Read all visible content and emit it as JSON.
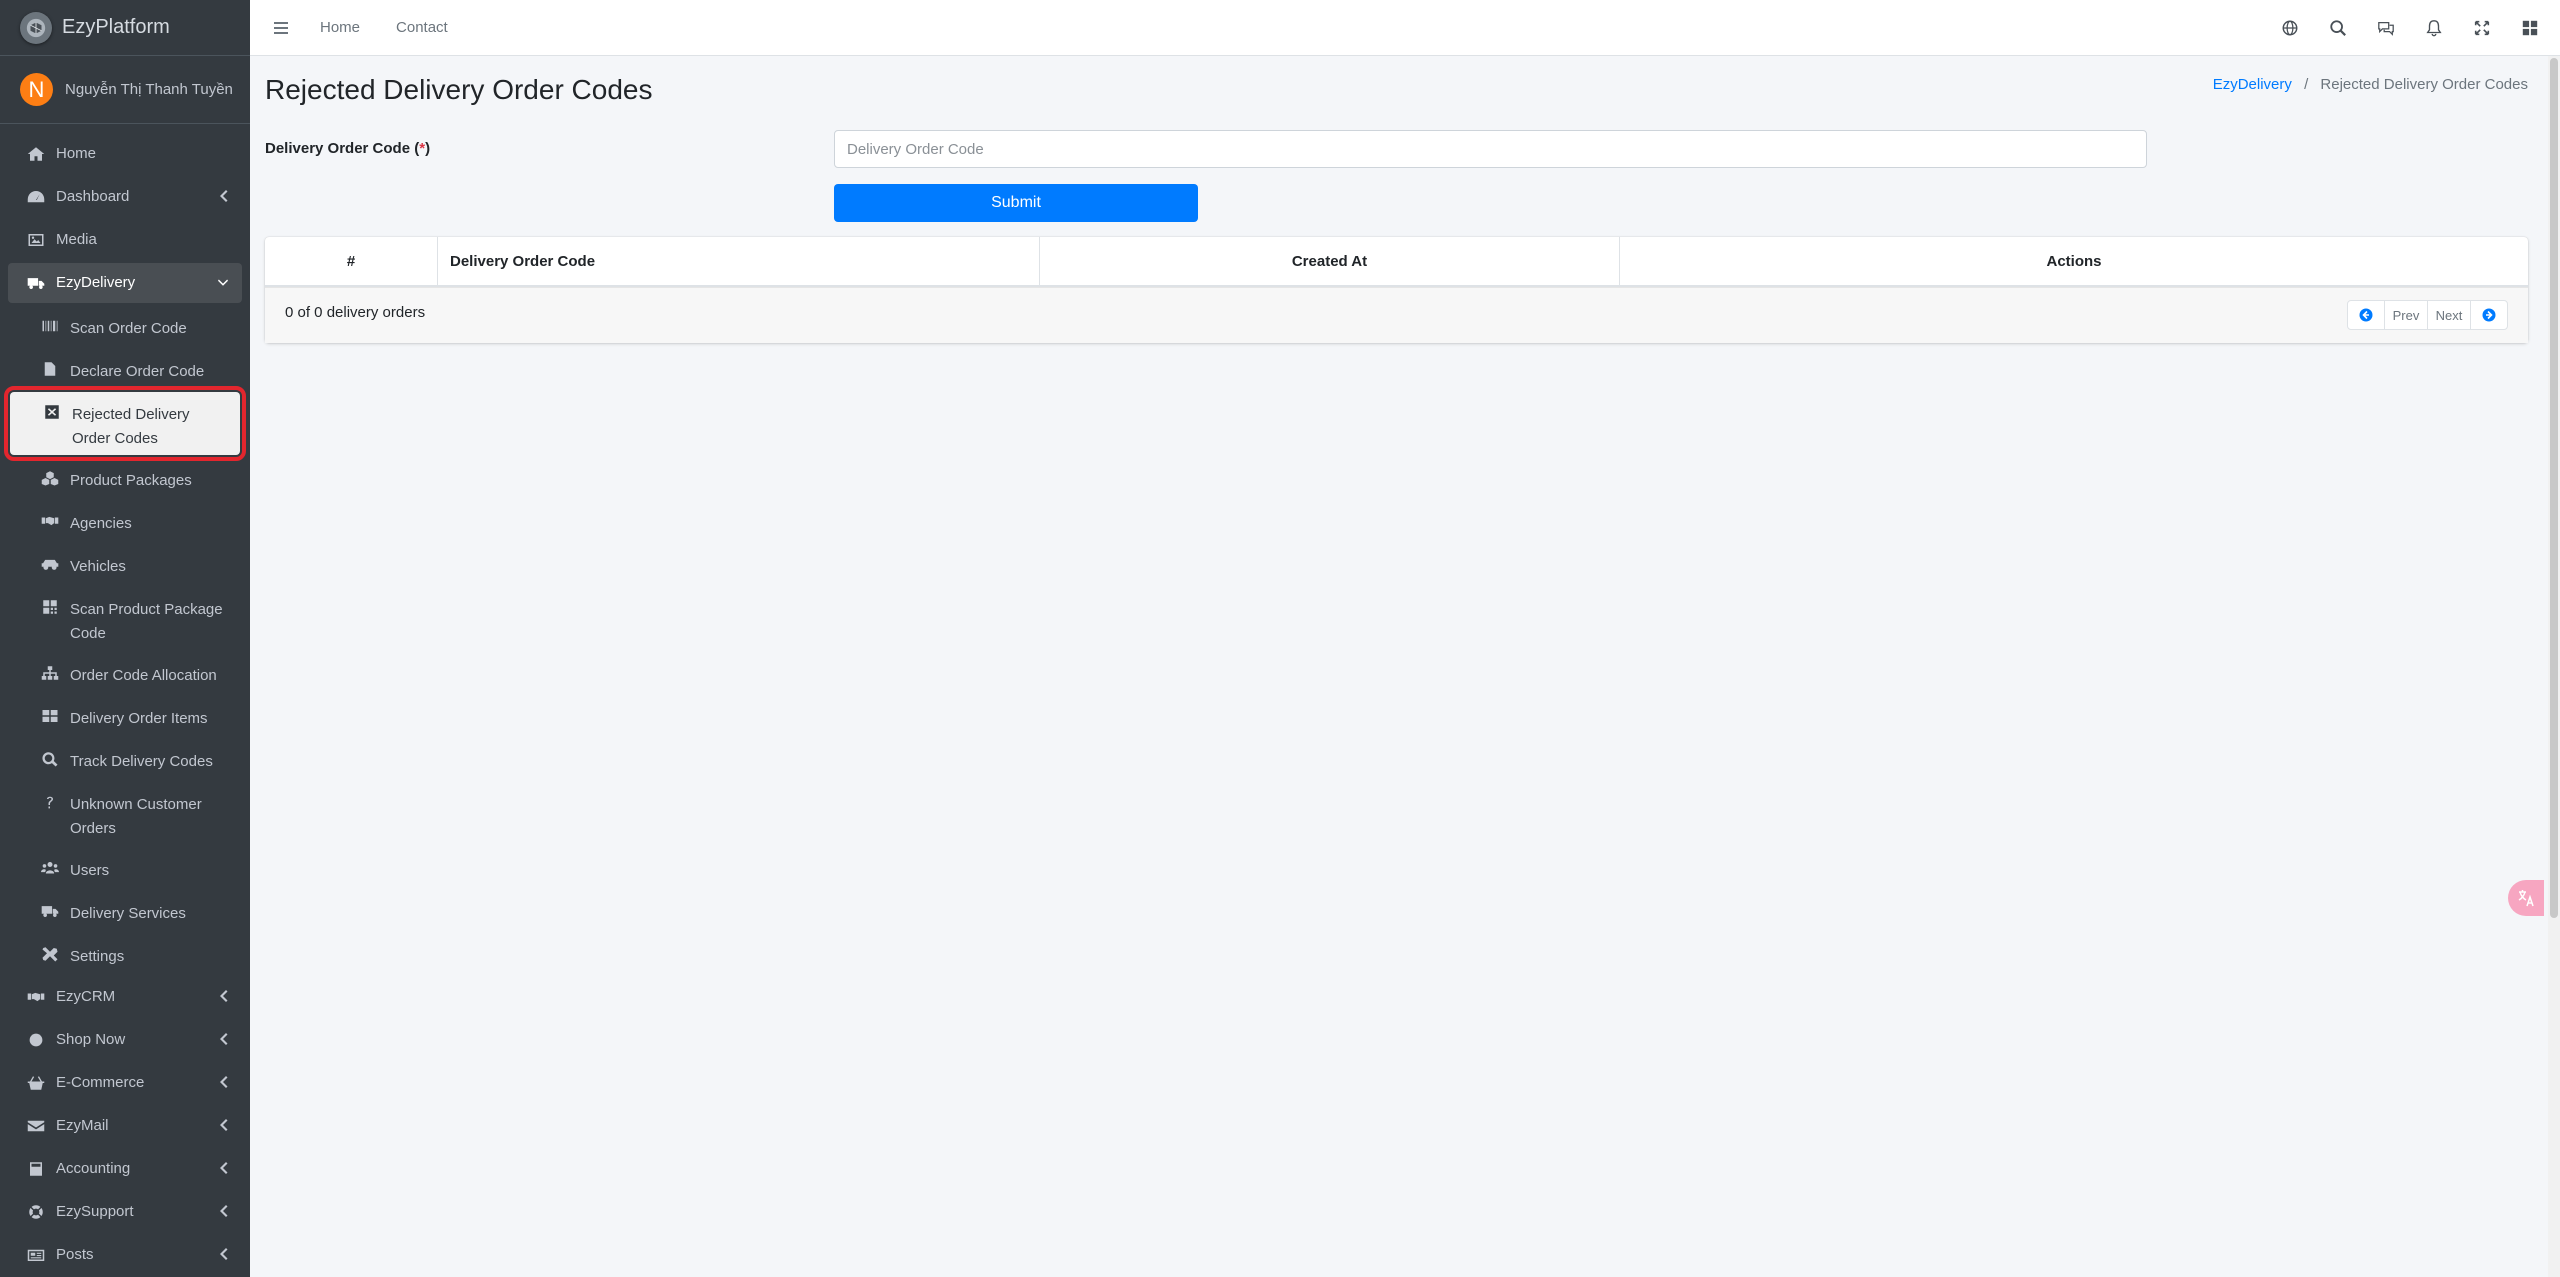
{
  "brand": {
    "name": "EzyPlatform"
  },
  "user": {
    "initial": "N",
    "name": "Nguyễn Thị Thanh Tuyền"
  },
  "topbar": {
    "links": [
      "Home",
      "Contact"
    ],
    "icons": [
      "globe-icon",
      "search-icon",
      "comments-icon",
      "bell-icon",
      "expand-icon",
      "apps-icon"
    ]
  },
  "sidebar": {
    "items": [
      {
        "label": "Home",
        "icon": "home-icon"
      },
      {
        "label": "Dashboard",
        "icon": "dashboard-icon"
      },
      {
        "label": "Media",
        "icon": "image-icon"
      },
      {
        "label": "EzyDelivery",
        "icon": "truck-icon"
      },
      {
        "label": "Scan Order Code",
        "icon": "barcode-icon"
      },
      {
        "label": "Declare Order Code",
        "icon": "file-icon"
      },
      {
        "label": "Rejected Delivery Order Codes",
        "icon": "x-square-icon"
      },
      {
        "label": "Product Packages",
        "icon": "cubes-icon"
      },
      {
        "label": "Agencies",
        "icon": "handshake-icon"
      },
      {
        "label": "Vehicles",
        "icon": "vehicles-icon"
      },
      {
        "label": "Scan Product Package Code",
        "icon": "qrcode-icon"
      },
      {
        "label": "Order Code Allocation",
        "icon": "sitemap-icon"
      },
      {
        "label": "Delivery Order Items",
        "icon": "table-icon"
      },
      {
        "label": "Track Delivery Codes",
        "icon": "search-icon"
      },
      {
        "label": "Unknown Customer Orders",
        "icon": "question-icon"
      },
      {
        "label": "Users",
        "icon": "users-icon"
      },
      {
        "label": "Delivery Services",
        "icon": "truck-icon"
      },
      {
        "label": "Settings",
        "icon": "tools-icon"
      },
      {
        "label": "EzyCRM",
        "icon": "handshake-icon"
      },
      {
        "label": "Shop Now",
        "icon": "circle-icon"
      },
      {
        "label": "E-Commerce",
        "icon": "basket-icon"
      },
      {
        "label": "EzyMail",
        "icon": "envelope-icon"
      },
      {
        "label": "Accounting",
        "icon": "calculator-icon"
      },
      {
        "label": "EzySupport",
        "icon": "lifering-icon"
      },
      {
        "label": "Posts",
        "icon": "newspaper-icon"
      }
    ]
  },
  "page": {
    "title": "Rejected Delivery Order Codes",
    "breadcrumb": {
      "parent": "EzyDelivery",
      "separator": "/",
      "current": "Rejected Delivery Order Codes"
    }
  },
  "form": {
    "label": "Delivery Order Code",
    "required_open": " (",
    "required_mark": "*",
    "required_close": ")",
    "input_placeholder": "Delivery Order Code",
    "input_value": "",
    "submit_label": "Submit"
  },
  "table": {
    "columns": [
      "#",
      "Delivery Order Code",
      "Created At",
      "Actions"
    ],
    "rows": [],
    "count_text": "0 of 0 delivery orders",
    "pager": {
      "prev": "Prev",
      "next": "Next"
    }
  },
  "colors": {
    "sidebar": "#343a40",
    "accent": "#007bff",
    "highlight_border": "#e3262e"
  }
}
